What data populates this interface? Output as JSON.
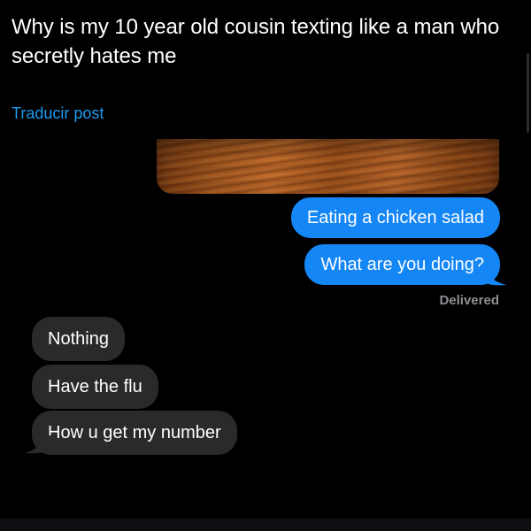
{
  "post": {
    "text": "Why is my 10 year old cousin texting like a man who secretly hates me",
    "translate_label": "Traducir post"
  },
  "conversation": {
    "photo_icon": "wood-table-photo",
    "sent_messages": [
      "Eating a chicken salad",
      "What are you doing?"
    ],
    "delivered_status": "Delivered",
    "received_messages": [
      "Nothing",
      "Have the flu",
      "How u get my number"
    ]
  },
  "colors": {
    "background": "#000000",
    "sent_bubble": "#1486f5",
    "received_bubble": "#2a2a2d",
    "link": "#1d9bf0",
    "status_text": "#8e8e93"
  }
}
